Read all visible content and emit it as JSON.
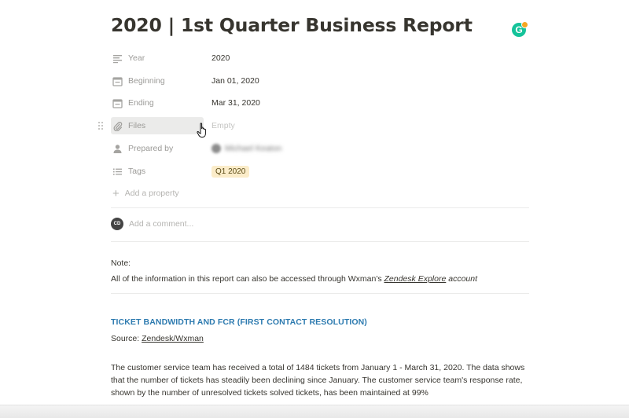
{
  "page": {
    "title": "2020 | 1st Quarter Business Report"
  },
  "properties": [
    {
      "label": "Year",
      "value": "2020",
      "icon": "text-lines-icon"
    },
    {
      "label": "Beginning",
      "value": "Jan 01, 2020",
      "icon": "calendar-icon"
    },
    {
      "label": "Ending",
      "value": "Mar 31, 2020",
      "icon": "calendar-icon"
    },
    {
      "label": "Files",
      "value": "Empty",
      "icon": "paperclip-icon"
    },
    {
      "label": "Prepared by",
      "value": "Michael Keaton",
      "icon": "person-icon"
    },
    {
      "label": "Tags",
      "value": "Q1 2020",
      "icon": "list-icon"
    }
  ],
  "add_property": "Add a property",
  "comment": {
    "placeholder": "Add a comment...",
    "avatar_initials": "CD"
  },
  "note": {
    "label": "Note:",
    "text_before": "All of the information in this report can also be accessed through Wxman's ",
    "link": "Zendesk Explore",
    "text_after": " account"
  },
  "section": {
    "heading": "TICKET BANDWIDTH AND FCR (FIRST CONTACT RESOLUTION)",
    "source_prefix": "Source: ",
    "source_link": "Zendesk/Wxman",
    "paragraph": "The customer service team has received a total of 1484 tickets from January 1 - March 31, 2020. The data shows that the number of tickets has steadily been declining since January. The customer service team's response rate, shown by the number of unresolved tickets solved tickets, has been maintained at 99%"
  },
  "colors": {
    "heading_accent": "#2e7bb0",
    "tag_bg": "#fbecc9",
    "grammarly_green": "#15c39a"
  },
  "grammarly": {
    "letter": "G"
  }
}
